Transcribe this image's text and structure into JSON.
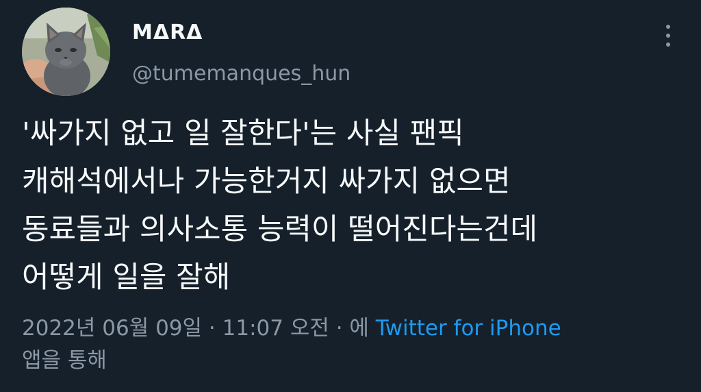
{
  "author": {
    "display_name": "MΔRΔ",
    "handle": "@tumemanques_hun",
    "avatar": "gray kitten photo"
  },
  "more_icon": "more-vertical-icon",
  "tweet": {
    "text_lines": [
      "'싸가지 없고 일 잘한다'는 사실 팬픽",
      "캐해석에서나 가능한거지 싸가지 없으면",
      "동료들과 의사소통 능력이 떨어진다는건데",
      "어떻게 일을 잘해"
    ]
  },
  "meta": {
    "date": "2022년 06월 09일",
    "separator": " · ",
    "time": "11:07 오전",
    "via_prefix": "에 ",
    "source": "Twitter for iPhone",
    "via_suffix": "앱을 통해"
  },
  "colors": {
    "background": "#15202b",
    "primary_text": "#f7f9f9",
    "secondary_text": "#8b98a5",
    "link": "#1d9bf0"
  }
}
